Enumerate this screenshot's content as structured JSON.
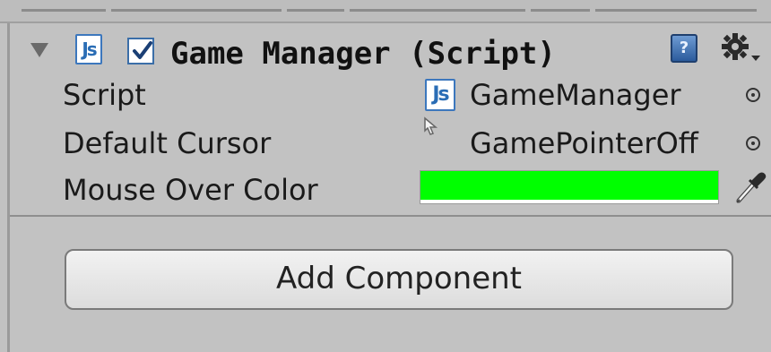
{
  "component": {
    "title": "Game Manager (Script)",
    "enabled": true,
    "expanded": true,
    "script_icon_text": "Js",
    "help_icon_text": "?"
  },
  "properties": {
    "script": {
      "label": "Script",
      "value": "GameManager"
    },
    "default_cursor": {
      "label": "Default Cursor",
      "value": "GamePointerOff"
    },
    "mouse_over_color": {
      "label": "Mouse Over Color",
      "color": "#00ff00"
    }
  },
  "buttons": {
    "add_component": "Add Component"
  },
  "icons": [
    "foldout-arrow-icon",
    "js-script-icon",
    "checkbox-icon",
    "help-book-icon",
    "gear-icon",
    "object-picker-icon",
    "cursor-texture-icon",
    "eyedropper-icon"
  ],
  "colors": {
    "background": "#c2c2c2",
    "accent": "#3c77bd"
  }
}
